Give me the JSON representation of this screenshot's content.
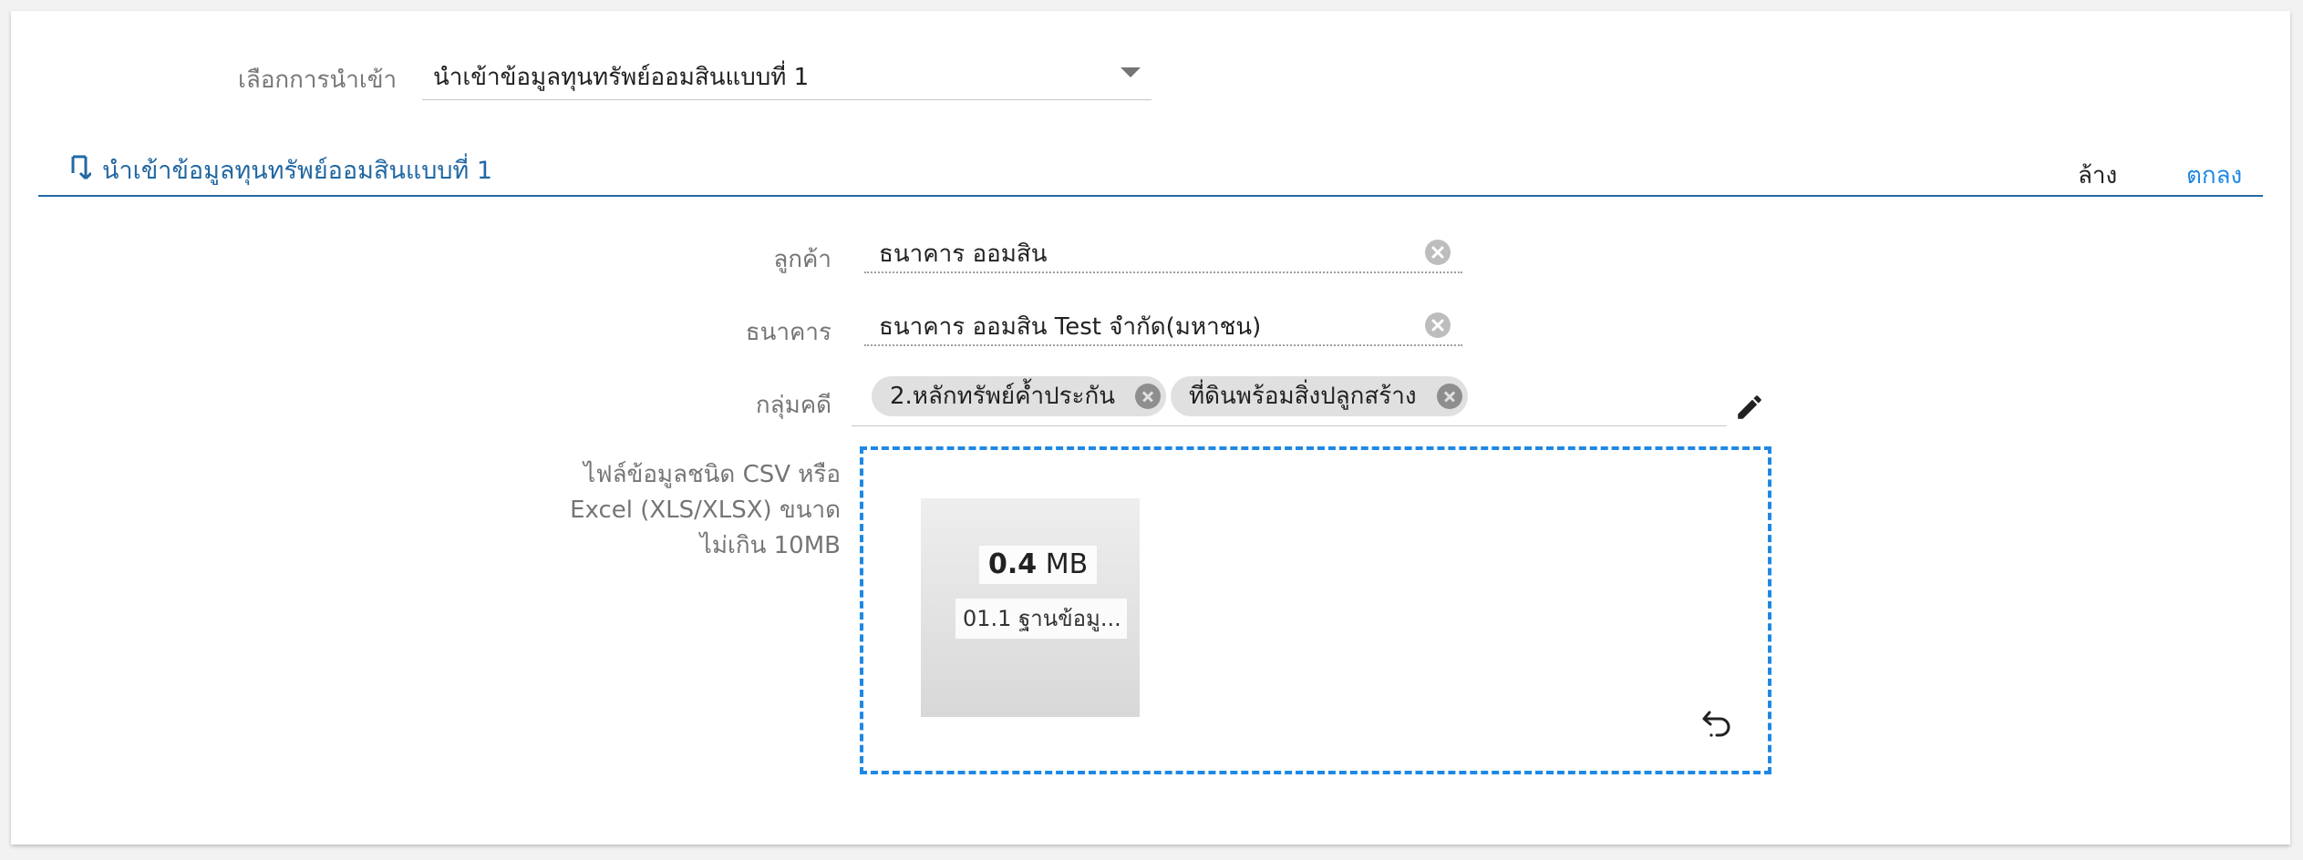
{
  "import_select": {
    "label": "เลือกการนำเข้า",
    "value": "นำเข้าข้อมูลทุนทรัพย์ออมสินแบบที่ 1"
  },
  "section": {
    "icon": "import-arrow-icon",
    "title": "นำเข้าข้อมูลทุนทรัพย์ออมสินแบบที่ 1",
    "clear_label": "ล้าง",
    "ok_label": "ตกลง"
  },
  "form": {
    "customer": {
      "label": "ลูกค้า",
      "value": "ธนาคาร ออมสิน"
    },
    "bank": {
      "label": "ธนาคาร",
      "value": "ธนาคาร ออมสิน Test จำกัด(มหาชน)"
    },
    "case_group": {
      "label": "กลุ่มคดี",
      "chips": [
        "2.หลักทรัพย์ค้ำประกัน",
        "ที่ดินพร้อมสิ่งปลูกสร้าง"
      ]
    },
    "upload": {
      "label_lines": [
        "ไฟล์ข้อมูลชนิด CSV หรือ",
        "Excel (XLS/XLSX) ขนาด",
        "ไม่เกิน 10MB"
      ],
      "file": {
        "size_value": "0.4",
        "size_unit": "MB",
        "name": "01.1 ฐานข้อมู..."
      }
    }
  },
  "colors": {
    "accent": "#1e88e5",
    "section_blue": "#2368a2",
    "chip_bg": "#e0e0e0"
  }
}
